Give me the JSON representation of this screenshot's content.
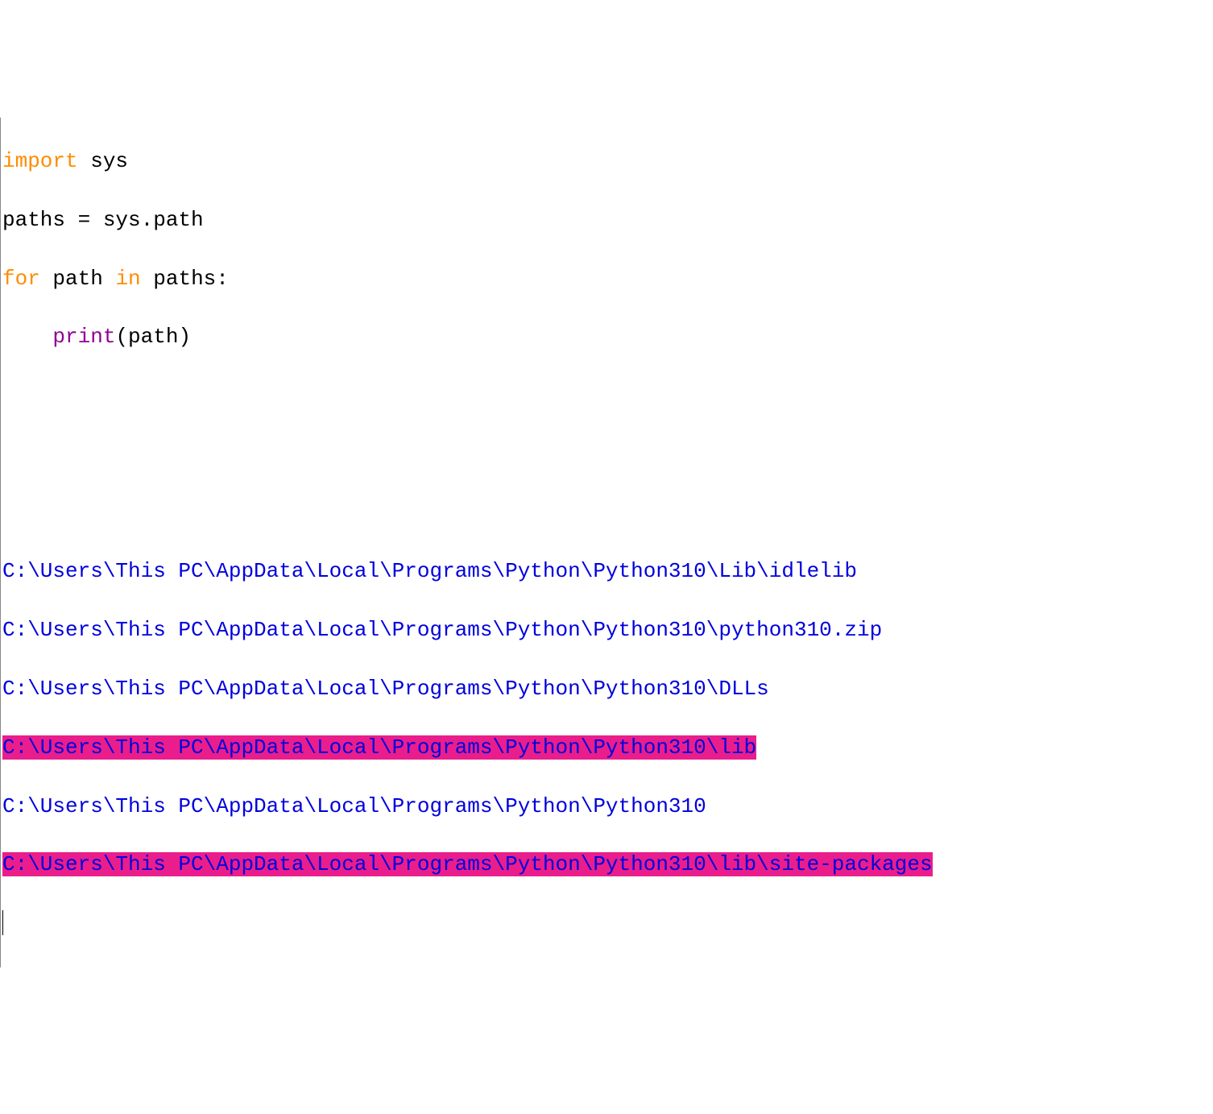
{
  "code": {
    "line1": {
      "import": "import",
      "sys": " sys"
    },
    "line2": "paths = sys.path",
    "line3": {
      "for": "for",
      "mid": " path ",
      "in": "in",
      "end": " paths:"
    },
    "line4": {
      "indent": "    ",
      "print": "print",
      "args": "(path)"
    }
  },
  "output": {
    "path1": "C:\\Users\\This PC\\AppData\\Local\\Programs\\Python\\Python310\\Lib\\idlelib",
    "path2": "C:\\Users\\This PC\\AppData\\Local\\Programs\\Python\\Python310\\python310.zip",
    "path3": "C:\\Users\\This PC\\AppData\\Local\\Programs\\Python\\Python310\\DLLs",
    "path4": "C:\\Users\\This PC\\AppData\\Local\\Programs\\Python\\Python310\\lib",
    "path5": "C:\\Users\\This PC\\AppData\\Local\\Programs\\Python\\Python310",
    "path6": "C:\\Users\\This PC\\AppData\\Local\\Programs\\Python\\Python310\\lib\\site-packages"
  }
}
